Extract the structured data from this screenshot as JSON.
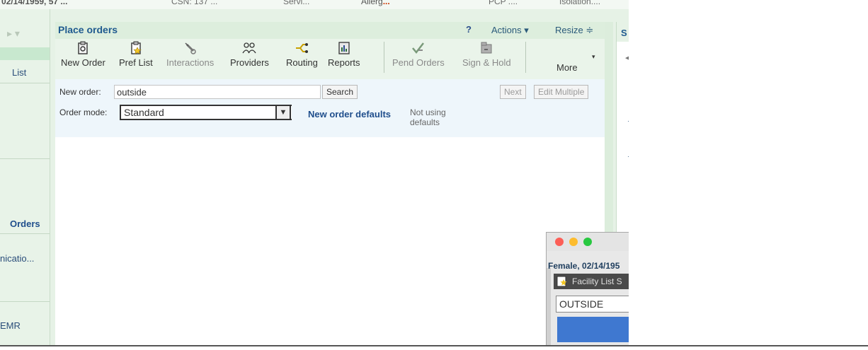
{
  "header": {
    "dob": "02/14/1959, 57 ...",
    "code_snip": "CSN: 137 ...",
    "service": "Servi...",
    "allergies": "Allerg",
    "allergies_dots": "...",
    "pcp": "PCP ....",
    "isolation": "Isolation...."
  },
  "sidebar": {
    "nav": "▸  ▾",
    "items": [
      {
        "label": "List"
      },
      {
        "label": "Orders"
      },
      {
        "label": "nicatio..."
      },
      {
        "label": "EMR"
      }
    ]
  },
  "panel": {
    "title": "Place orders",
    "help": "?",
    "actions": "Actions ▾",
    "resize": "Resize ≑"
  },
  "toolbar": {
    "buttons": [
      {
        "label": "New Order",
        "icon": "clipboard-icon"
      },
      {
        "label": "Pref List",
        "icon": "star-clipboard-icon"
      },
      {
        "label": "Interactions",
        "icon": "syringe-icon"
      },
      {
        "label": "Providers",
        "icon": "people-icon"
      },
      {
        "label": "Routing",
        "icon": "routing-icon"
      },
      {
        "label": "Reports",
        "icon": "report-icon"
      },
      {
        "label": "Pend Orders",
        "icon": "pend-check-icon"
      },
      {
        "label": "Sign & Hold",
        "icon": "sign-hold-icon"
      }
    ],
    "more": "More"
  },
  "form": {
    "new_order_label": "New order:",
    "new_order_value": "outside",
    "search": "Search",
    "next": "Next",
    "edit_multiple": "Edit Multiple",
    "order_mode_label": "Order mode:",
    "order_mode_value": "Standard",
    "defaults_link": "New order defaults",
    "not_using_line1": "Not using",
    "not_using_line2": "defaults"
  },
  "right_panel": {
    "letter": "S"
  },
  "popup": {
    "patient": "Female, 02/14/195",
    "window_title": "Facility List S",
    "field_value": "OUTSIDE"
  },
  "colors": {
    "accent_title": "#1f5a8f",
    "panel_bg": "#e6f2e6",
    "popup_blue": "#3f78d0",
    "close": "#fc5f57",
    "minimize": "#fdbc2e",
    "zoom": "#28c840"
  }
}
